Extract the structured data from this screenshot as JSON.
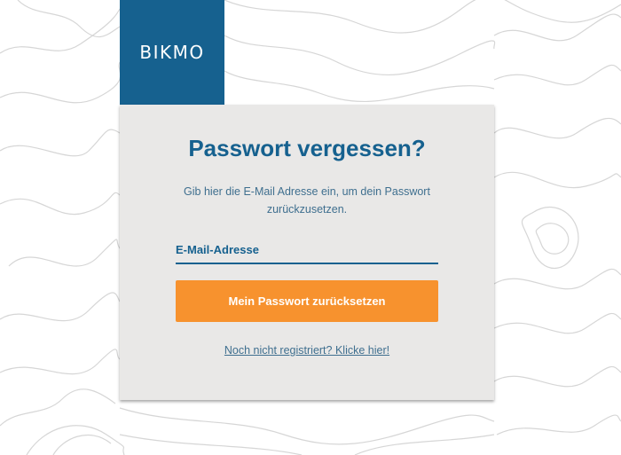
{
  "brand": {
    "logo_text": "BIKMO",
    "primary_color": "#16618f",
    "accent_color": "#f7922e"
  },
  "form": {
    "title": "Passwort vergessen?",
    "instructions": "Gib hier die E-Mail Adresse ein, um dein Passwort zurückzusetzen.",
    "email_value": "",
    "email_placeholder": "E-Mail-Adresse",
    "submit_label": "Mein Passwort zurücksetzen",
    "register_link": "Noch nicht registriert? Klicke hier!"
  }
}
